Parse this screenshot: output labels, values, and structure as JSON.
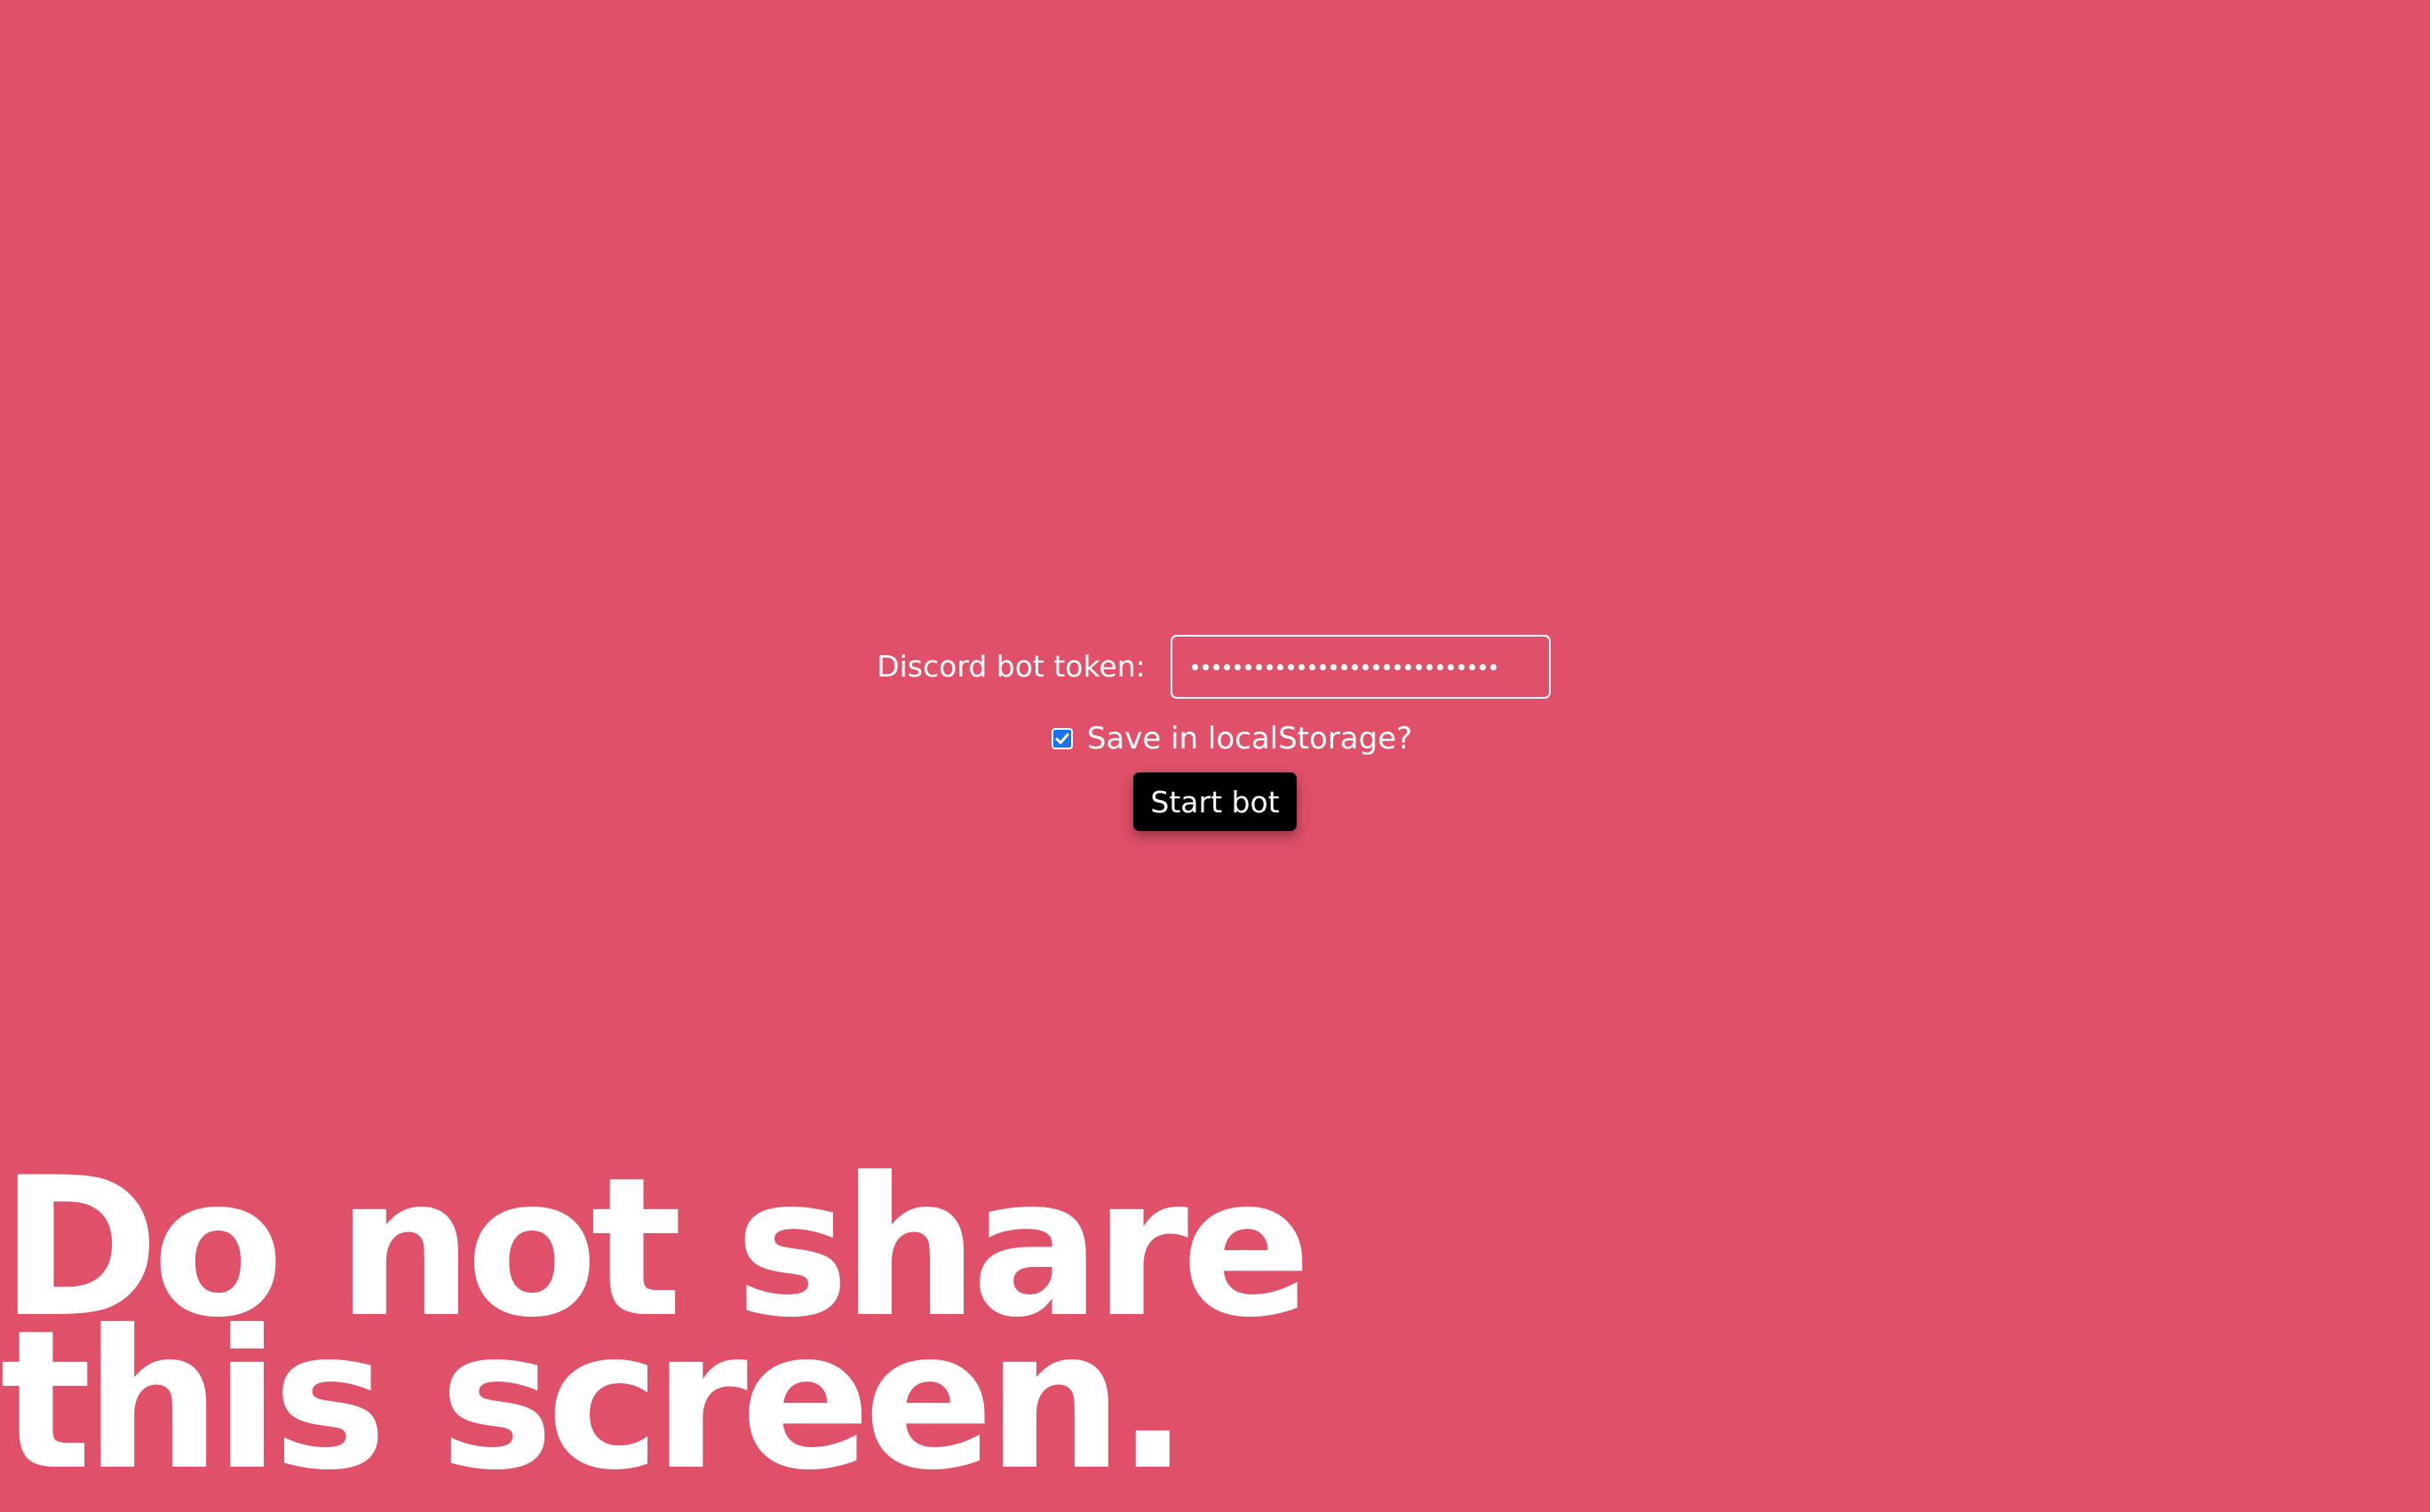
{
  "form": {
    "token_label": "Discord bot token:",
    "token_value": "•••••••••••••••••••••••••••••",
    "save_checked": true,
    "save_label": "Save in localStorage?",
    "start_label": "Start bot"
  },
  "warning": {
    "line1": "Do not share",
    "line2": "this screen."
  },
  "colors": {
    "background": "#e05068",
    "text": "#ffffff",
    "button": "#000000",
    "checkbox": "#1a73e8"
  }
}
